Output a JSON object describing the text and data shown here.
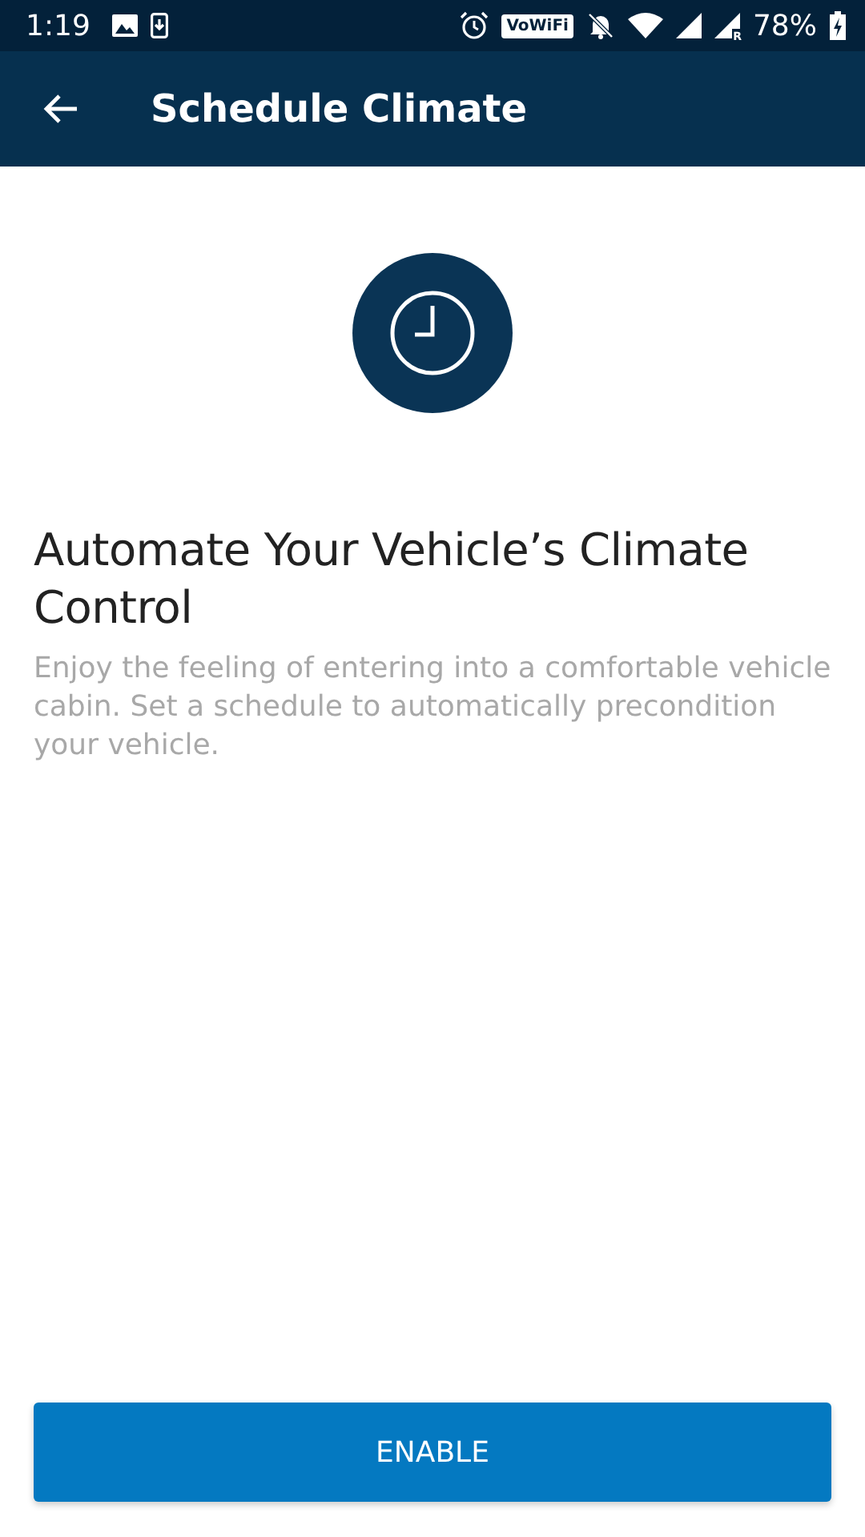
{
  "status_bar": {
    "time": "1:19",
    "vowifi": "VoWiFi",
    "roaming_mark": "R",
    "battery": "78%"
  },
  "app_bar": {
    "title": "Schedule Climate"
  },
  "intro": {
    "heading": "Automate Your Vehicle’s Climate Control",
    "body": "Enjoy the feeling of entering into a comfortable vehicle cabin. Set a schedule to automatically precondition your vehicle."
  },
  "buttons": [
    {
      "label": "ENABLE",
      "kind": "primary"
    }
  ]
}
